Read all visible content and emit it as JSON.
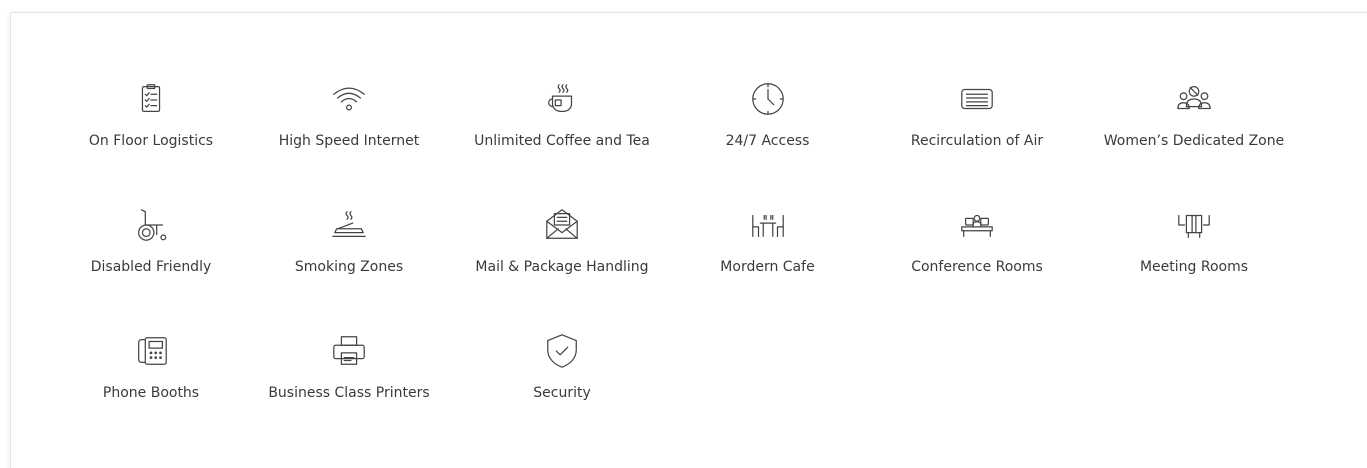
{
  "amenities": [
    {
      "label": "On Floor Logistics",
      "icon": "clipboard-checklist-icon"
    },
    {
      "label": "High Speed Internet",
      "icon": "wifi-icon"
    },
    {
      "label": "Unlimited Coffee and Tea",
      "icon": "coffee-cup-icon"
    },
    {
      "label": "24/7 Access",
      "icon": "clock-icon"
    },
    {
      "label": "Recirculation of Air",
      "icon": "air-vent-icon"
    },
    {
      "label": "Women’s Dedicated Zone",
      "icon": "women-group-icon"
    },
    {
      "label": "Disabled Friendly",
      "icon": "wheelchair-icon"
    },
    {
      "label": "Smoking Zones",
      "icon": "smoking-zone-icon"
    },
    {
      "label": "Mail & Package Handling",
      "icon": "mail-envelope-icon"
    },
    {
      "label": "Mordern Cafe",
      "icon": "cafe-tables-icon"
    },
    {
      "label": "Conference Rooms",
      "icon": "conference-room-icon"
    },
    {
      "label": "Meeting Rooms",
      "icon": "meeting-room-icon"
    },
    {
      "label": "Phone Booths",
      "icon": "desk-phone-icon"
    },
    {
      "label": "Business Class Printers",
      "icon": "printer-icon"
    },
    {
      "label": "Security",
      "icon": "shield-check-icon"
    }
  ],
  "colors": {
    "icon_stroke": "#444444",
    "label_text": "#3a3a3a",
    "panel_border": "#e3e3e3"
  }
}
